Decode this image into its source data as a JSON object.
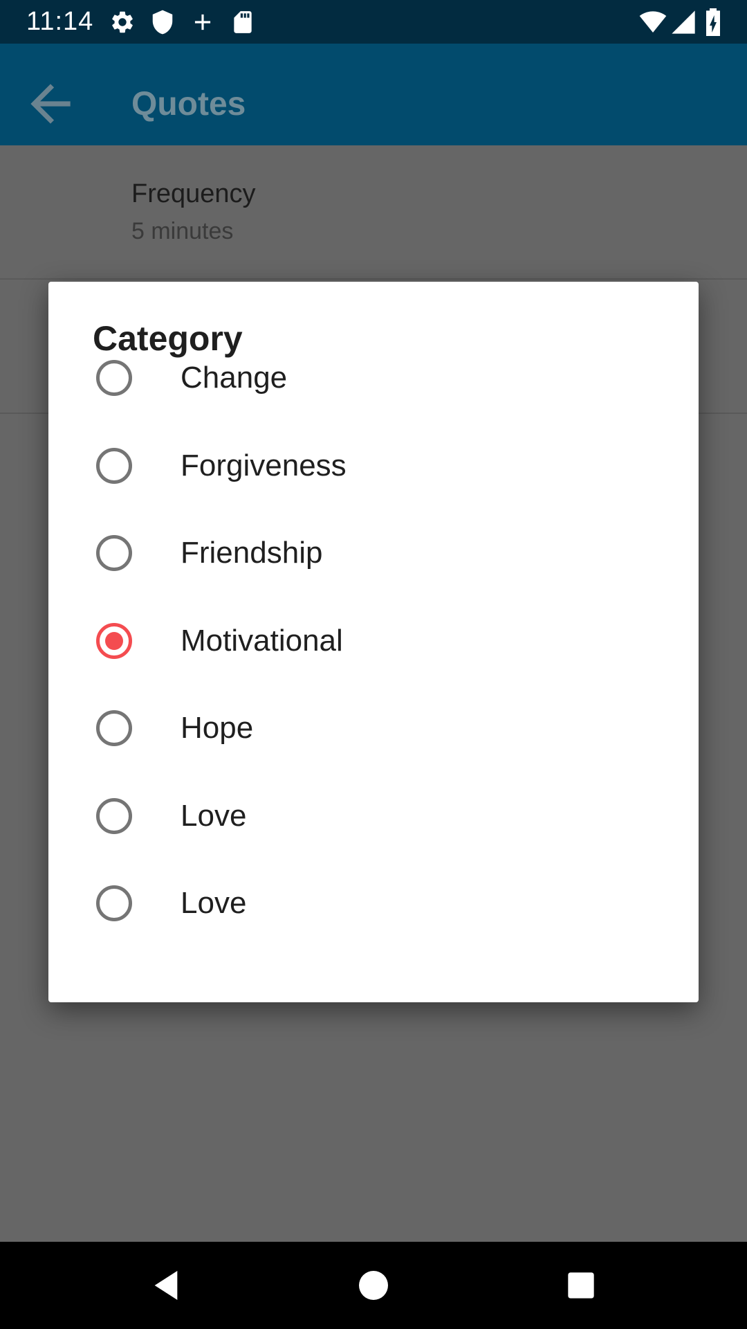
{
  "status_bar": {
    "time": "11:14",
    "left_icons": [
      "gear-icon",
      "shield-icon",
      "plus-icon",
      "sd-card-icon"
    ],
    "right_icons": [
      "wifi-icon",
      "cell-signal-icon",
      "battery-charging-icon"
    ]
  },
  "app_bar": {
    "title": "Quotes",
    "back_icon": "arrow-back-icon"
  },
  "preferences": [
    {
      "title": "Frequency",
      "summary": "5 minutes"
    }
  ],
  "dialog": {
    "title": "Category",
    "options": [
      {
        "label": "Change",
        "selected": false
      },
      {
        "label": "Forgiveness",
        "selected": false
      },
      {
        "label": "Friendship",
        "selected": false
      },
      {
        "label": "Motivational",
        "selected": true
      },
      {
        "label": "Hope",
        "selected": false
      },
      {
        "label": "Love",
        "selected": false
      },
      {
        "label": "Love",
        "selected": false
      }
    ]
  },
  "nav_bar": {
    "buttons": [
      "back-triangle-icon",
      "home-circle-icon",
      "recents-square-icon"
    ]
  },
  "colors": {
    "status_bar": "#022b40",
    "app_bar": "#024b6d",
    "scrim_background": "#666666",
    "dialog_background": "#ffffff",
    "radio_selected": "#f44c50",
    "radio_unselected": "#757575",
    "nav_bar": "#000000"
  }
}
